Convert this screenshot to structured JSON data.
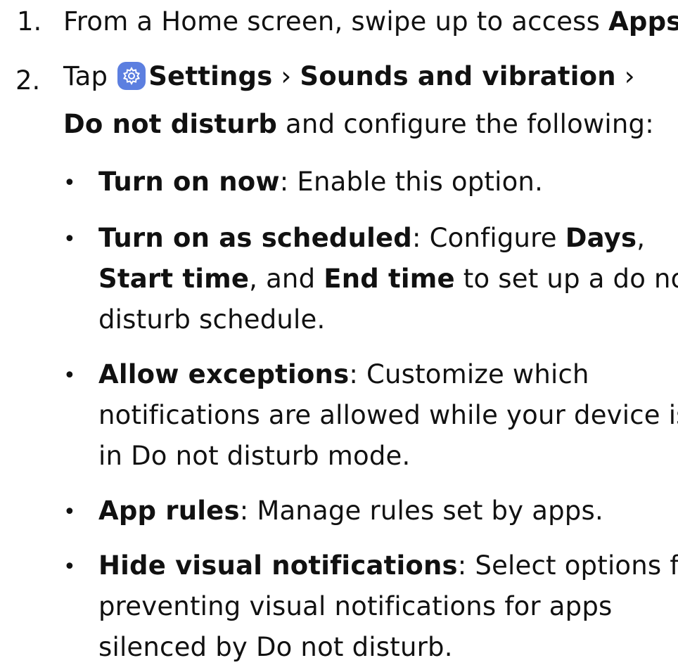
{
  "steps": [
    {
      "number": "1.",
      "pre": "From a Home screen, swipe up to access ",
      "bold": "Apps",
      "post": "."
    },
    {
      "number": "2.",
      "pre": "Tap ",
      "icon": "settings-gear-icon",
      "settings": "Settings",
      "sep1": " › ",
      "sounds": "Sounds and vibration",
      "sep2": " ›",
      "line2_bold": "Do not disturb",
      "line2_rest": " and configure the following:"
    }
  ],
  "bullets": [
    {
      "label": "Turn on now",
      "text": ": Enable this option."
    },
    {
      "label": "Turn on as scheduled",
      "text1": ": Configure ",
      "days": "Days",
      "comma": ",",
      "start": "Start time",
      "and": ", and ",
      "end": "End time",
      "text2": " to set up a do not",
      "line3": "disturb schedule."
    },
    {
      "label": "Allow exceptions",
      "text1": ": Customize which",
      "line2": "notifications are allowed while your device is",
      "line3": "in Do not disturb mode."
    },
    {
      "label": "App rules",
      "text": ": Manage rules set by apps."
    },
    {
      "label": "Hide visual notifications",
      "text1": ": Select options for",
      "line2": "preventing visual notifications for apps",
      "line3": "silenced by Do not disturb."
    }
  ],
  "bullet_char": "•",
  "colors": {
    "text": "#111111",
    "settings_icon_bg": "#5c7fe0"
  }
}
